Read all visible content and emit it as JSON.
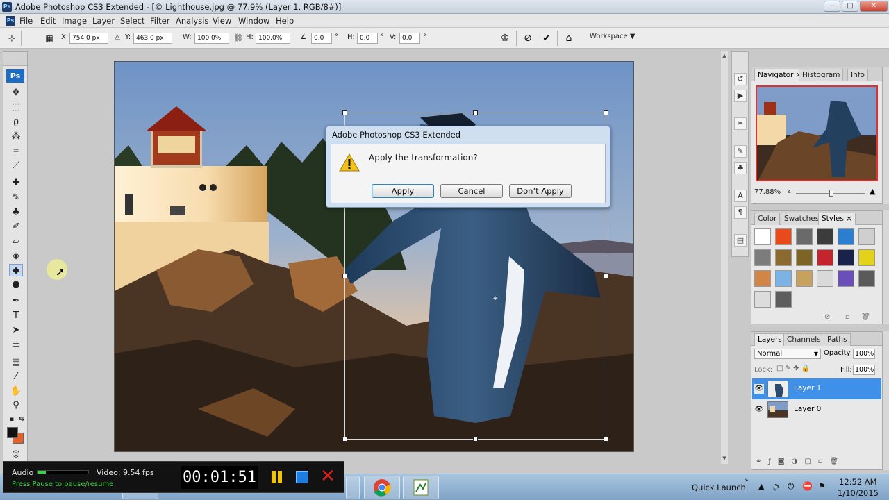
{
  "window": {
    "title": "Adobe Photoshop CS3 Extended - [© Lighthouse.jpg @ 77.9% (Layer 1, RGB/8#)]",
    "badge": "Ps",
    "controls": {
      "minimize": "—",
      "maximize": "□",
      "close": "✕"
    }
  },
  "menubar": {
    "items": [
      "File",
      "Edit",
      "Image",
      "Layer",
      "Select",
      "Filter",
      "Analysis",
      "View",
      "Window",
      "Help"
    ]
  },
  "options": {
    "x_label": "X:",
    "x_value": "754.0 px",
    "y_label": "Y:",
    "y_value": "463.0 px",
    "w_label": "W:",
    "w_value": "100.0%",
    "h_label": "H:",
    "h_value": "100.0%",
    "angle_value": "0.0",
    "degree": "°",
    "hskew_label": "H:",
    "hskew_value": "0.0",
    "vskew_label": "V:",
    "vskew_value": "0.0",
    "workspace": "Workspace ▼"
  },
  "toolbox": {
    "logo": "Ps",
    "tools": [
      "move-tool-icon",
      "marquee-tool-icon",
      "lasso-tool-icon",
      "magic-wand-icon",
      "crop-tool-icon",
      "slice-tool-icon",
      "healing-brush-icon",
      "brush-tool-icon",
      "clone-stamp-icon",
      "history-brush-icon",
      "eraser-tool-icon",
      "paint-bucket-icon",
      "blur-tool-icon",
      "dodge-tool-icon",
      "pen-tool-icon",
      "type-tool-icon",
      "path-selection-icon",
      "shape-tool-icon",
      "notes-tool-icon",
      "eyedropper-tool-icon",
      "hand-tool-icon",
      "zoom-tool-icon"
    ],
    "foreground_color": "#111111",
    "background_color": "#e8612a"
  },
  "dialog": {
    "title": "Adobe Photoshop CS3 Extended",
    "message": "Apply the transformation?",
    "buttons": {
      "apply": "Apply",
      "cancel": "Cancel",
      "dont_apply": "Don’t Apply"
    }
  },
  "panels": {
    "navigator": {
      "tabs": [
        "Navigator ×",
        "Histogram",
        "Info"
      ],
      "zoom": "77.88%"
    },
    "color": {
      "tabs": [
        "Color",
        "Swatches",
        "Styles ×"
      ],
      "style_colors": [
        "#ffffff",
        "#e94a1c",
        "#6a6a6a",
        "#3c3c3c",
        "#2c7fd0",
        "#cfcfcf",
        "#7c7c7c",
        "#8a6a2f",
        "#7b6424",
        "#c4252c",
        "#18224a",
        "#e3d21a",
        "#d18547",
        "#7db3e4",
        "#c7a25e",
        "#d9d9d9",
        "#6b4fb8",
        "#5a5a5a",
        "#dcdcdc",
        "#5d5d5d"
      ]
    },
    "layers": {
      "tabs": [
        "Layers ×",
        "Channels",
        "Paths"
      ],
      "blend_mode": "Normal",
      "opacity_label": "Opacity:",
      "opacity": "100%",
      "lock_label": "Lock:",
      "fill_label": "Fill:",
      "fill": "100%",
      "items": [
        {
          "name": "Layer 1",
          "selected": true
        },
        {
          "name": "Layer 0",
          "selected": false
        }
      ]
    }
  },
  "recorder": {
    "audio_label": "Audio",
    "video_label": "Video: 9.54 fps",
    "hint": "Press Pause to pause/resume",
    "timer": "00:01:51"
  },
  "taskbar": {
    "quick_launch": "Quick Launch",
    "time": "12:52 AM",
    "date": "1/10/2015"
  }
}
